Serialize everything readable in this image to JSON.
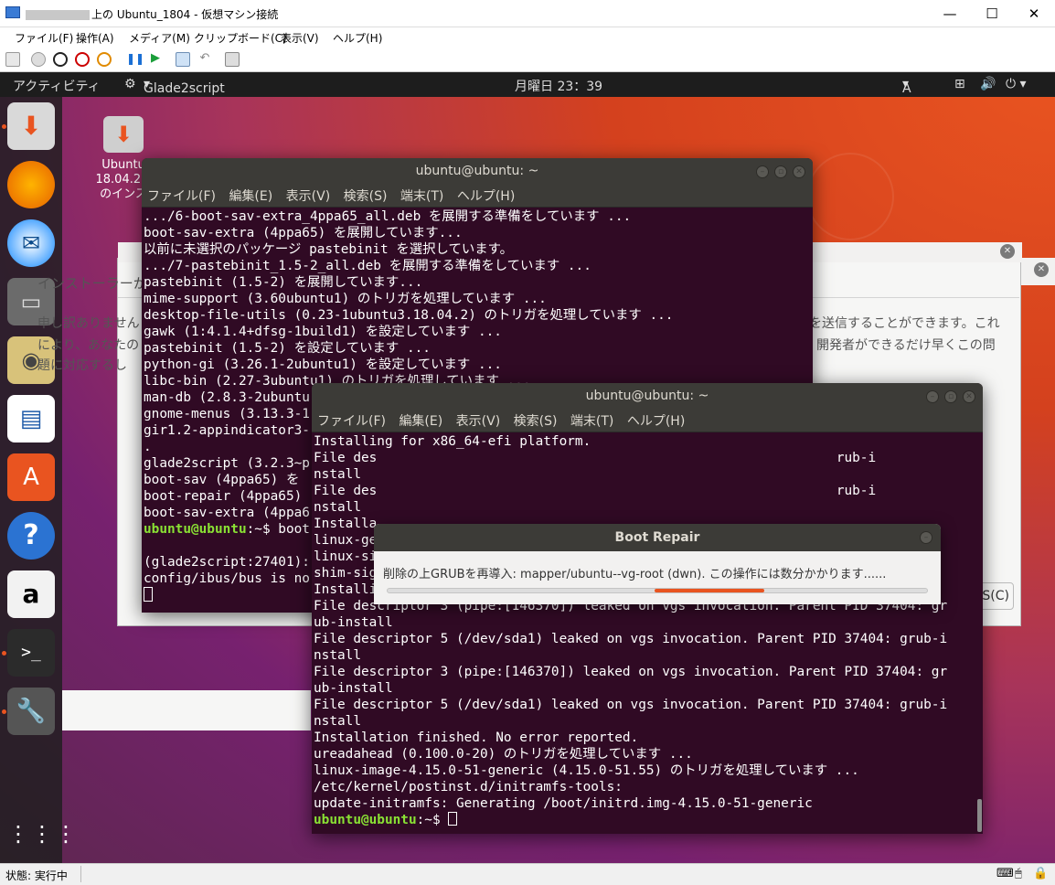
{
  "host": {
    "title": "上の Ubuntu_1804 - 仮想マシン接続",
    "menu": [
      "ファイル(F)",
      "操作(A)",
      "メディア(M)",
      "クリップボード(C)",
      "表示(V)",
      "ヘルプ(H)"
    ],
    "status_label": "状態: 実行中"
  },
  "topbar": {
    "activities": "アクティビティ",
    "app": "Glade2script",
    "clock": "月曜日 23：39",
    "input": "A"
  },
  "desktop_icon": {
    "line1": "Ubuntu",
    "line2": "18.04.2 L",
    "line3": "のインス"
  },
  "installer": {
    "title": "インストーラーか",
    "text_left1": "申し訳ありません",
    "text_left2": "により、あなたの",
    "text_left3": "題に対応するし",
    "text_right1": "を送信することができます。これ",
    "text_right2": "開発者ができるだけ早くこの問",
    "button_suffix": "S(C)"
  },
  "term1": {
    "title": "ubuntu@ubuntu: ~",
    "menu": [
      "ファイル(F)",
      "編集(E)",
      "表示(V)",
      "検索(S)",
      "端末(T)",
      "ヘルプ(H)"
    ],
    "lines": [
      ".../6-boot-sav-extra_4ppa65_all.deb を展開する準備をしています ...",
      "boot-sav-extra (4ppa65) を展開しています...",
      "以前に未選択のパッケージ pastebinit を選択しています。",
      ".../7-pastebinit_1.5-2_all.deb を展開する準備をしています ...",
      "pastebinit (1.5-2) を展開しています...",
      "mime-support (3.60ubuntu1) のトリガを処理しています ...",
      "desktop-file-utils (0.23-1ubuntu3.18.04.2) のトリガを処理しています ...",
      "gawk (1:4.1.4+dfsg-1build1) を設定しています ...",
      "pastebinit (1.5-2) を設定しています ...",
      "python-gi (3.26.1-2ubuntu1) を設定しています ...",
      "libc-bin (2.27-3ubuntu1) のトリガを処理しています ...",
      "man-db (2.8.3-2ubuntu",
      "gnome-menus (3.13.3-1",
      "gir1.2-appindicator3-",
      ".",
      "glade2script (3.2.3~p",
      "boot-sav (4ppa65) を",
      "boot-repair (4ppa65)",
      "boot-sav-extra (4ppa6"
    ],
    "prompt_user": "ubuntu@ubuntu",
    "prompt_rest": ":~$ boot",
    "line_a": "",
    "line_b": "(glade2script:27401):",
    "line_c": "config/ibus/bus is no"
  },
  "term2": {
    "title": "ubuntu@ubuntu: ~",
    "menu": [
      "ファイル(F)",
      "編集(E)",
      "表示(V)",
      "検索(S)",
      "端末(T)",
      "ヘルプ(H)"
    ],
    "lines_top": [
      "Installing for x86_64-efi platform.",
      "File des                                                          rub-i",
      "nstall",
      "File des                                                          rub-i",
      "nstall",
      "Installa"
    ],
    "lines": [
      "linux-generic (4.15.0.51.53) を設定しています ...",
      "linux-signed-generic (4.15.0.51.53) を設定しています ...",
      "shim-signed (1.37~18.04.3+15+1533136590.3beb971-0ubuntu1) を設定しています ...",
      "Installing for x86_64-efi platform.",
      "File descriptor 3 (pipe:[146370]) leaked on vgs invocation. Parent PID 37404: gr",
      "ub-install",
      "File descriptor 5 (/dev/sda1) leaked on vgs invocation. Parent PID 37404: grub-i",
      "nstall",
      "File descriptor 3 (pipe:[146370]) leaked on vgs invocation. Parent PID 37404: gr",
      "ub-install",
      "File descriptor 5 (/dev/sda1) leaked on vgs invocation. Parent PID 37404: grub-i",
      "nstall",
      "Installation finished. No error reported.",
      "ureadahead (0.100.0-20) のトリガを処理しています ...",
      "linux-image-4.15.0-51-generic (4.15.0-51.55) のトリガを処理しています ...",
      "/etc/kernel/postinst.d/initramfs-tools:",
      "update-initramfs: Generating /boot/initrd.img-4.15.0-51-generic"
    ],
    "prompt_user": "ubuntu@ubuntu",
    "prompt_rest": ":~$ "
  },
  "bootrepair": {
    "title": "Boot Repair",
    "message": "削除の上GRUBを再導入: mapper/ubuntu--vg-root (dwn). この操作には数分かかります......",
    "progress_fraction": 0.2
  },
  "colors": {
    "accent": "#e95420",
    "terminal_bg": "#300a24",
    "prompt": "#8ae234"
  }
}
